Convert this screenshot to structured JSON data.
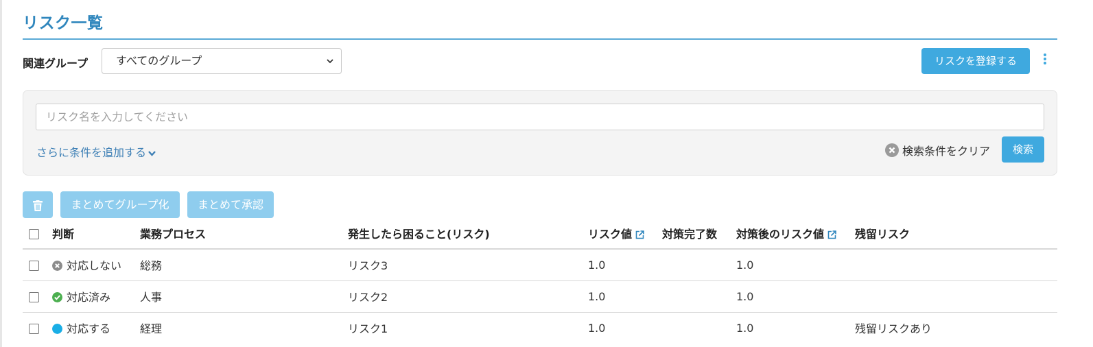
{
  "page": {
    "title": "リスク一覧"
  },
  "filter": {
    "group_label": "関連グループ",
    "group_selected": "すべてのグループ",
    "register_label": "リスクを登録する"
  },
  "search": {
    "placeholder": "リスク名を入力してください",
    "add_condition_label": "さらに条件を追加する",
    "clear_label": "検索条件をクリア",
    "search_label": "検索"
  },
  "bulk": {
    "group_label": "まとめてグループ化",
    "approve_label": "まとめて承認"
  },
  "table": {
    "headers": {
      "judgement": "判断",
      "process": "業務プロセス",
      "risk": "発生したら困ること(リスク)",
      "risk_value": "リスク値",
      "done_count": "対策完了数",
      "after_value": "対策後のリスク値",
      "residual": "残留リスク"
    },
    "rows": [
      {
        "status": "対応しない",
        "status_icon": "x-circle-icon",
        "status_color": "#8c8c8c",
        "process": "総務",
        "risk": "リスク3",
        "risk_value": "1.0",
        "done_count": "",
        "after_value": "1.0",
        "residual": ""
      },
      {
        "status": "対応済み",
        "status_icon": "check-circle-icon",
        "status_color": "#4caf50",
        "process": "人事",
        "risk": "リスク2",
        "risk_value": "1.0",
        "done_count": "",
        "after_value": "1.0",
        "residual": ""
      },
      {
        "status": "対応する",
        "status_icon": "circle-icon",
        "status_color": "#1aaee6",
        "process": "経理",
        "risk": "リスク1",
        "risk_value": "1.0",
        "done_count": "",
        "after_value": "1.0",
        "residual": "残留リスクあり"
      }
    ]
  },
  "colors": {
    "accent": "#3fa9df",
    "accent_light": "#8fcdee",
    "title": "#2f86bd",
    "link": "#3d7fb5"
  }
}
